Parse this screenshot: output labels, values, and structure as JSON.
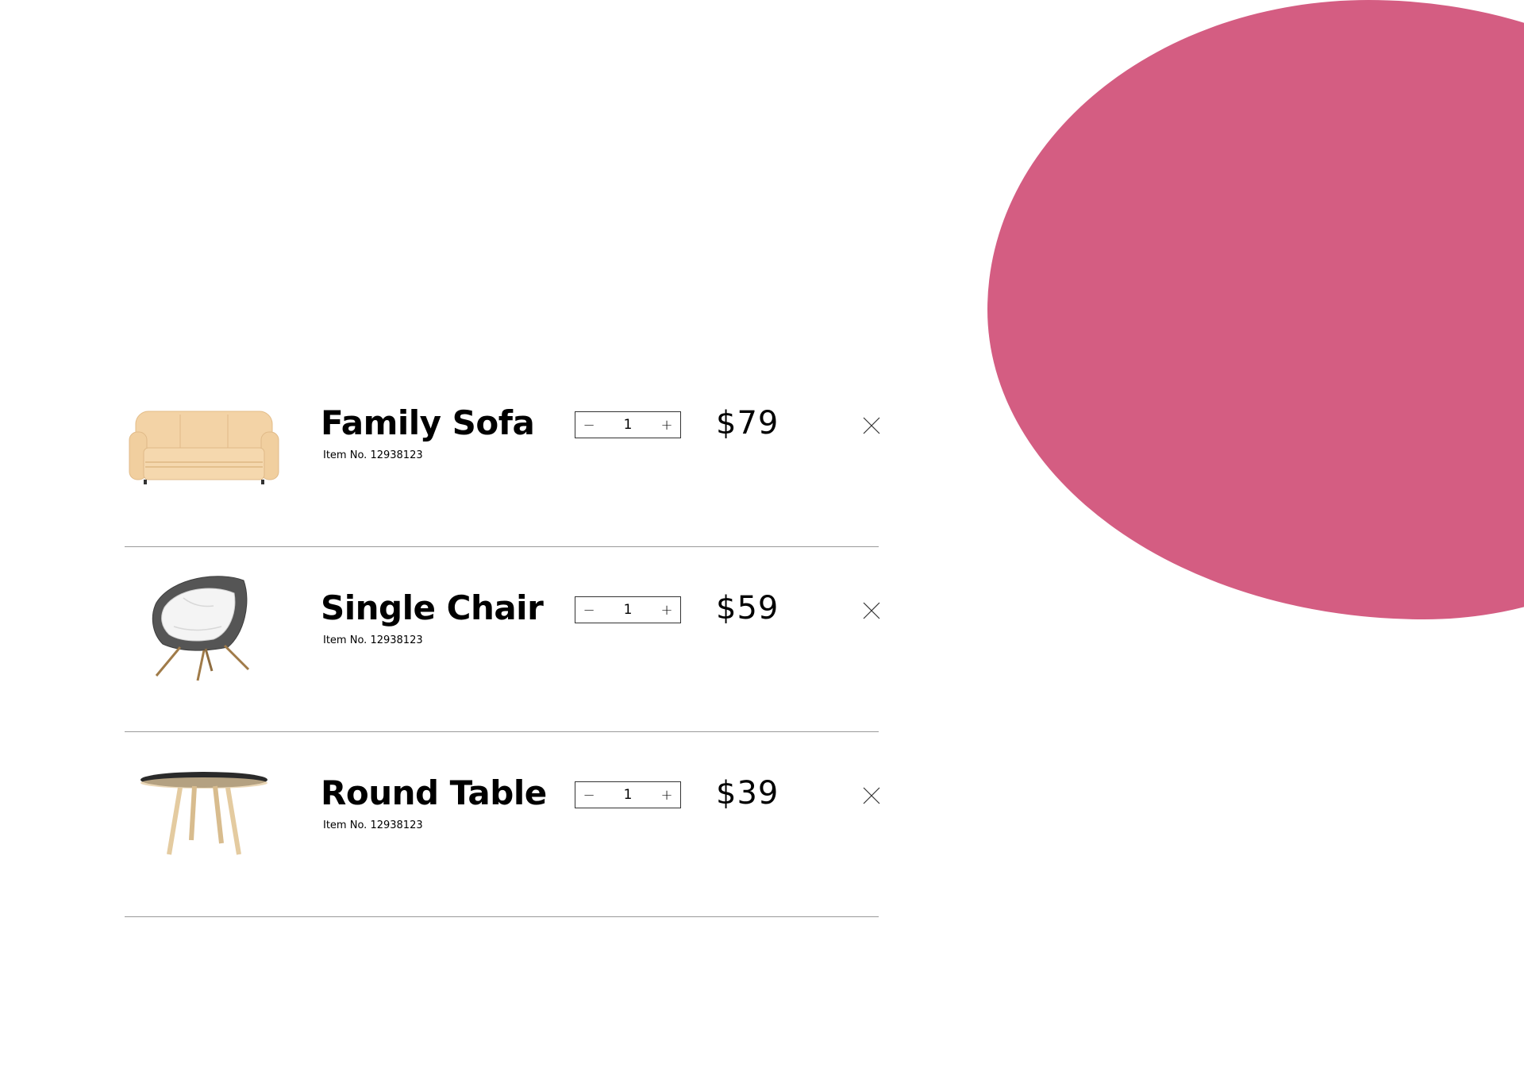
{
  "theme": {
    "accent": "#D45D82"
  },
  "cart": {
    "items": [
      {
        "name": "Family Sofa",
        "sku": "Item No. 12938123",
        "quantity": "1",
        "price": "$79",
        "image_icon": "sofa-image",
        "decrement": "−",
        "increment": "+"
      },
      {
        "name": "Single Chair",
        "sku": "Item No. 12938123",
        "quantity": "1",
        "price": "$59",
        "image_icon": "chair-image",
        "decrement": "−",
        "increment": "+"
      },
      {
        "name": "Round Table",
        "sku": "Item No. 12938123",
        "quantity": "1",
        "price": "$39",
        "image_icon": "table-image",
        "decrement": "−",
        "increment": "+"
      }
    ]
  }
}
